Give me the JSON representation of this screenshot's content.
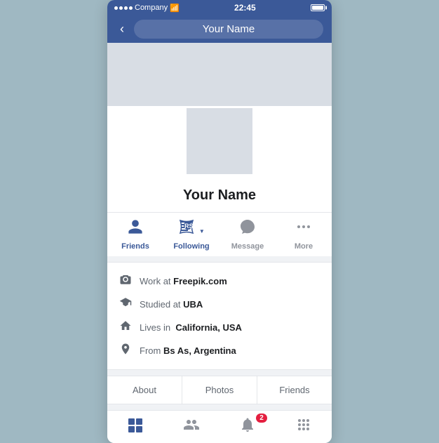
{
  "statusBar": {
    "carrier": "Company",
    "time": "22:45",
    "signalDots": 4,
    "wifiLabel": "wifi"
  },
  "navBar": {
    "backLabel": "‹",
    "title": "Your Name"
  },
  "profile": {
    "name": "Your Name"
  },
  "actions": [
    {
      "id": "friends",
      "icon": "👤",
      "label": "Friends",
      "active": true
    },
    {
      "id": "following",
      "icon": "📡",
      "label": "Following",
      "active": true,
      "dropdown": true
    },
    {
      "id": "message",
      "icon": "💬",
      "label": "Message",
      "active": false
    },
    {
      "id": "more",
      "icon": "···",
      "label": "More",
      "active": false
    }
  ],
  "infoRows": [
    {
      "id": "work",
      "icon": "🎓",
      "prefix": "Work at ",
      "value": "Freepik.com"
    },
    {
      "id": "studied",
      "icon": "🎓",
      "prefix": "Studied at ",
      "value": "UBA"
    },
    {
      "id": "lives",
      "icon": "🏠",
      "prefix": "Lives in  ",
      "value": "California, USA"
    },
    {
      "id": "from",
      "icon": "📍",
      "prefix": "From ",
      "value": "Bs As, Argentina"
    }
  ],
  "tabs": [
    {
      "id": "about",
      "label": "About"
    },
    {
      "id": "photos",
      "label": "Photos"
    },
    {
      "id": "friends",
      "label": "Friends"
    }
  ],
  "bottomNav": [
    {
      "id": "home",
      "icon": "⬛",
      "badge": null
    },
    {
      "id": "friends",
      "icon": "👥",
      "badge": null
    },
    {
      "id": "notifications",
      "icon": "🔔",
      "badge": "2"
    },
    {
      "id": "menu",
      "icon": "⋮⋮",
      "badge": null
    }
  ]
}
